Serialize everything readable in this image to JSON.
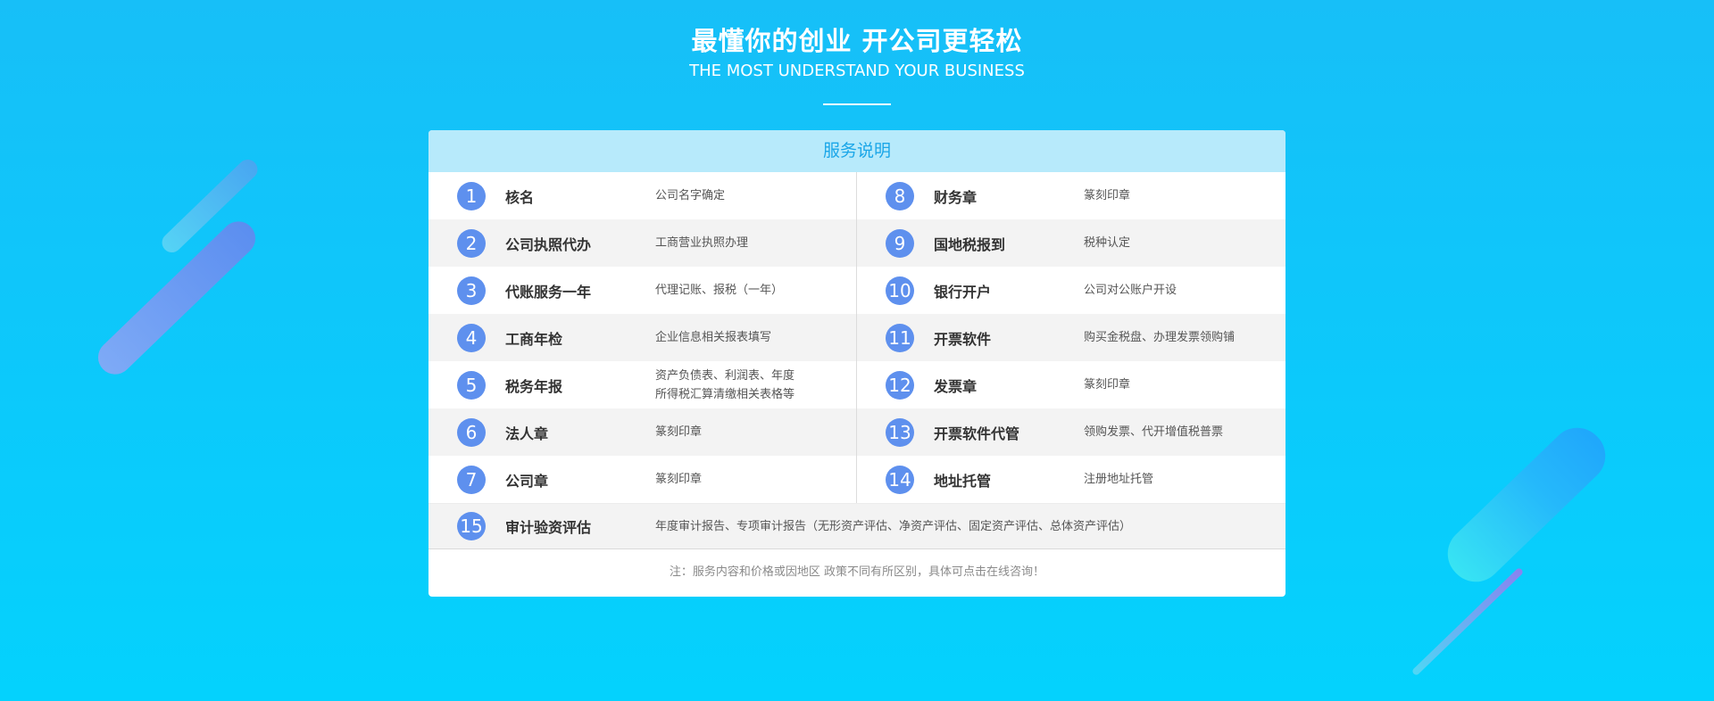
{
  "header": {
    "title": "最懂你的创业 开公司更轻松",
    "subtitle": "THE MOST UNDERSTAND YOUR BUSINESS"
  },
  "card": {
    "heading": "服务说明",
    "rows": [
      {
        "left": {
          "num": "1",
          "name": "核名",
          "desc": "公司名字确定"
        },
        "right": {
          "num": "8",
          "name": "财务章",
          "desc": "篆刻印章"
        }
      },
      {
        "left": {
          "num": "2",
          "name": "公司执照代办",
          "desc": "工商营业执照办理"
        },
        "right": {
          "num": "9",
          "name": "国地税报到",
          "desc": "税种认定"
        }
      },
      {
        "left": {
          "num": "3",
          "name": "代账服务一年",
          "desc": "代理记账、报税（一年）"
        },
        "right": {
          "num": "10",
          "name": "银行开户",
          "desc": "公司对公账户开设"
        }
      },
      {
        "left": {
          "num": "4",
          "name": "工商年检",
          "desc": "企业信息相关报表填写"
        },
        "right": {
          "num": "11",
          "name": "开票软件",
          "desc": "购买金税盘、办理发票领购铺"
        }
      },
      {
        "left": {
          "num": "5",
          "name": "税务年报",
          "desc": "资产负债表、利润表、年度",
          "desc2": "所得税汇算清缴相关表格等"
        },
        "right": {
          "num": "12",
          "name": "发票章",
          "desc": "篆刻印章"
        }
      },
      {
        "left": {
          "num": "6",
          "name": "法人章",
          "desc": "篆刻印章"
        },
        "right": {
          "num": "13",
          "name": "开票软件代管",
          "desc": "领购发票、代开增值税普票"
        }
      },
      {
        "left": {
          "num": "7",
          "name": "公司章",
          "desc": "篆刻印章"
        },
        "right": {
          "num": "14",
          "name": "地址托管",
          "desc": "注册地址托管"
        }
      }
    ],
    "full_row": {
      "num": "15",
      "name": "审计验资评估",
      "desc": "年度审计报告、专项审计报告（无形资产评估、净资产评估、固定资产评估、总体资产评估）"
    },
    "note": "注：服务内容和价格或因地区 政策不同有所区别，具体可点击在线咨询！"
  },
  "colors": {
    "background": "#12c4f9",
    "number_badge": "#5e90ee",
    "heading_bar": "#b7eafb",
    "heading_text": "#1aa6e8"
  }
}
